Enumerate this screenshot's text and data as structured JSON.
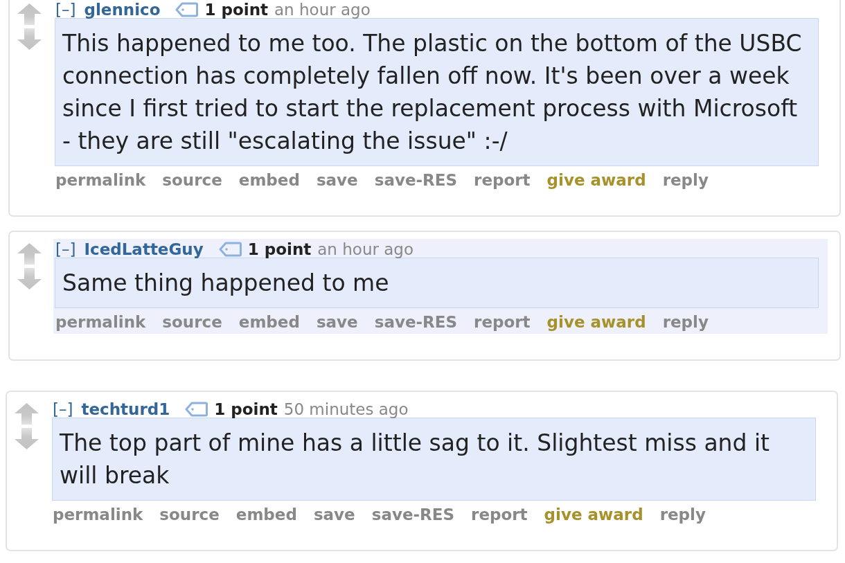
{
  "comments": [
    {
      "highlighted": false,
      "collapse": "[–]",
      "author": "glennico",
      "score": "1 point",
      "time": "an hour ago",
      "body": "This happened to me too. The plastic on the bottom of the USBC connection has completely fallen off now. It's been over a week since I first tried to start the replacement process with Microsoft - they are still \"escalating the issue\" :-/",
      "actions": [
        {
          "label": "permalink",
          "kind": "link"
        },
        {
          "label": "source",
          "kind": "link"
        },
        {
          "label": "embed",
          "kind": "link"
        },
        {
          "label": "save",
          "kind": "link"
        },
        {
          "label": "save-RES",
          "kind": "link"
        },
        {
          "label": "report",
          "kind": "link"
        },
        {
          "label": "give award",
          "kind": "award"
        },
        {
          "label": "reply",
          "kind": "link"
        }
      ]
    },
    {
      "highlighted": true,
      "collapse": "[–]",
      "author": "IcedLatteGuy",
      "score": "1 point",
      "time": "an hour ago",
      "body": "Same thing happened to me",
      "actions": [
        {
          "label": "permalink",
          "kind": "link"
        },
        {
          "label": "source",
          "kind": "link"
        },
        {
          "label": "embed",
          "kind": "link"
        },
        {
          "label": "save",
          "kind": "link"
        },
        {
          "label": "save-RES",
          "kind": "link"
        },
        {
          "label": "report",
          "kind": "link"
        },
        {
          "label": "give award",
          "kind": "award"
        },
        {
          "label": "reply",
          "kind": "link"
        }
      ]
    },
    {
      "highlighted": false,
      "collapse": "[–]",
      "author": "techturd1",
      "score": "1 point",
      "time": "50 minutes ago",
      "body": "The top part of mine has a little sag to it. Slightest miss and it will break",
      "actions": [
        {
          "label": "permalink",
          "kind": "link"
        },
        {
          "label": "source",
          "kind": "link"
        },
        {
          "label": "embed",
          "kind": "link"
        },
        {
          "label": "save",
          "kind": "link"
        },
        {
          "label": "save-RES",
          "kind": "link"
        },
        {
          "label": "report",
          "kind": "link"
        },
        {
          "label": "give award",
          "kind": "award"
        },
        {
          "label": "reply",
          "kind": "link"
        }
      ]
    }
  ]
}
